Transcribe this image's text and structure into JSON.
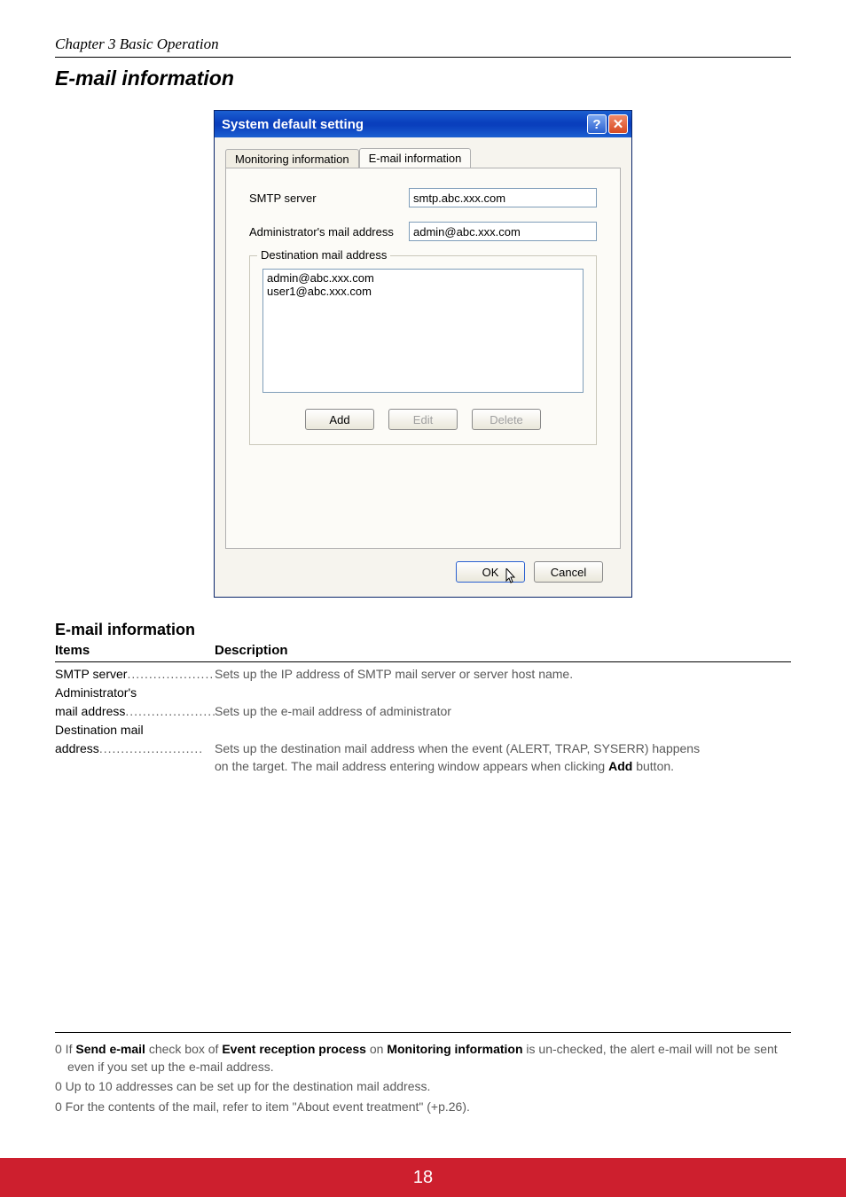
{
  "chapter": "Chapter 3 Basic Operation",
  "section_title": "E-mail information",
  "dialog": {
    "title": "System default setting",
    "tabs": {
      "monitoring": "Monitoring information",
      "email": "E-mail information"
    },
    "labels": {
      "smtp": "SMTP server",
      "admin": "Administrator's mail address",
      "group": "Destination mail address"
    },
    "values": {
      "smtp": "smtp.abc.xxx.com",
      "admin": "admin@abc.xxx.com",
      "list": "admin@abc.xxx.com\nuser1@abc.xxx.com"
    },
    "buttons": {
      "add": "Add",
      "edit": "Edit",
      "delete": "Delete",
      "ok": "OK",
      "cancel": "Cancel",
      "help": "?",
      "close": "✕"
    }
  },
  "table": {
    "heading": "E-mail information",
    "col_items": "Items",
    "col_desc": "Description",
    "rows": {
      "smtp_label": "SMTP server",
      "smtp_desc": "Sets up the IP address of SMTP mail server or server host name.",
      "admin_label1": "Administrator's",
      "admin_label2": "mail address",
      "admin_desc": "Sets up the e-mail address of administrator",
      "dest_label1": "Destination mail",
      "dest_label2": "address",
      "dest_desc1": "Sets up the destination mail address when the event (ALERT, TRAP, SYSERR) happens",
      "dest_desc2_pre": "on the target. The mail address entering window appears when clicking ",
      "dest_desc2_bold": "Add",
      "dest_desc2_post": " button."
    }
  },
  "footnotes": {
    "f1_pre": "0 If ",
    "f1_b1": "Send e-mail",
    "f1_mid1": " check box of ",
    "f1_b2": "Event reception process",
    "f1_mid2": " on ",
    "f1_b3": "Monitoring information",
    "f1_post": " is un-checked, the alert e-mail will not be sent even if you set up the e-mail address.",
    "f2": "0 Up to 10 addresses can be set up for the destination mail address.",
    "f3": "0 For the contents of the mail, refer to item \"About event treatment\" (+p.26)."
  },
  "page_number": "18"
}
